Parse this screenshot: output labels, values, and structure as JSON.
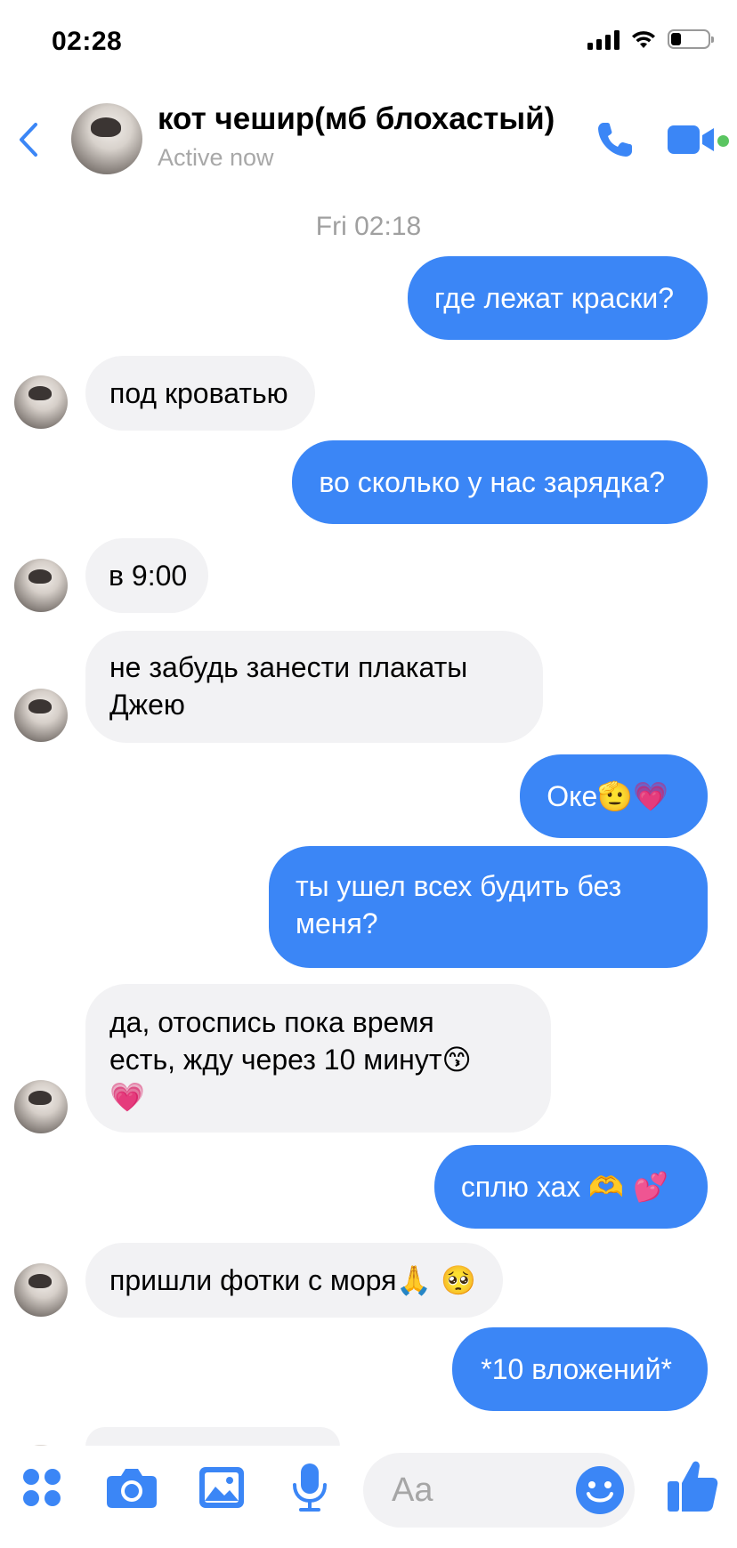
{
  "status": {
    "time": "02:28"
  },
  "header": {
    "name": "кот чешир(мб блохастый)",
    "status": "Active now"
  },
  "date_separator": "Fri 02:18",
  "messages": [
    {
      "from": "me",
      "text": "где лежат краски?"
    },
    {
      "from": "them",
      "text": "под кроватью"
    },
    {
      "from": "me",
      "text": "во сколько у нас зарядка?"
    },
    {
      "from": "them",
      "text": "в 9:00"
    },
    {
      "from": "them",
      "line1": "не забудь занести плакаты",
      "line2": "Джею"
    },
    {
      "from": "me",
      "text": "Оке",
      "emoji": "🫡💗"
    },
    {
      "from": "me",
      "line1": "ты ушел всех будить без",
      "line2": "меня?"
    },
    {
      "from": "them",
      "line1": "да, отоспись пока время",
      "line2": "есть, жду через 10 минут",
      "line2_emoji": "😙",
      "line3_emoji": "💗"
    },
    {
      "from": "me",
      "text": "сплю хах ",
      "emoji": "🫶 💕"
    },
    {
      "from": "them",
      "text": "пришли фотки с моря",
      "emoji": "🙏 🥺"
    },
    {
      "from": "me",
      "text": "*10 вложений*"
    }
  ],
  "composer": {
    "placeholder": "Aa"
  },
  "colors": {
    "accent": "#3b86f6",
    "incoming_bg": "#f2f2f4",
    "online": "#5ac561"
  },
  "icons": [
    "back-icon",
    "phone-icon",
    "video-icon",
    "apps-icon",
    "camera-icon",
    "gallery-icon",
    "mic-icon",
    "emoji-icon",
    "like-icon"
  ]
}
